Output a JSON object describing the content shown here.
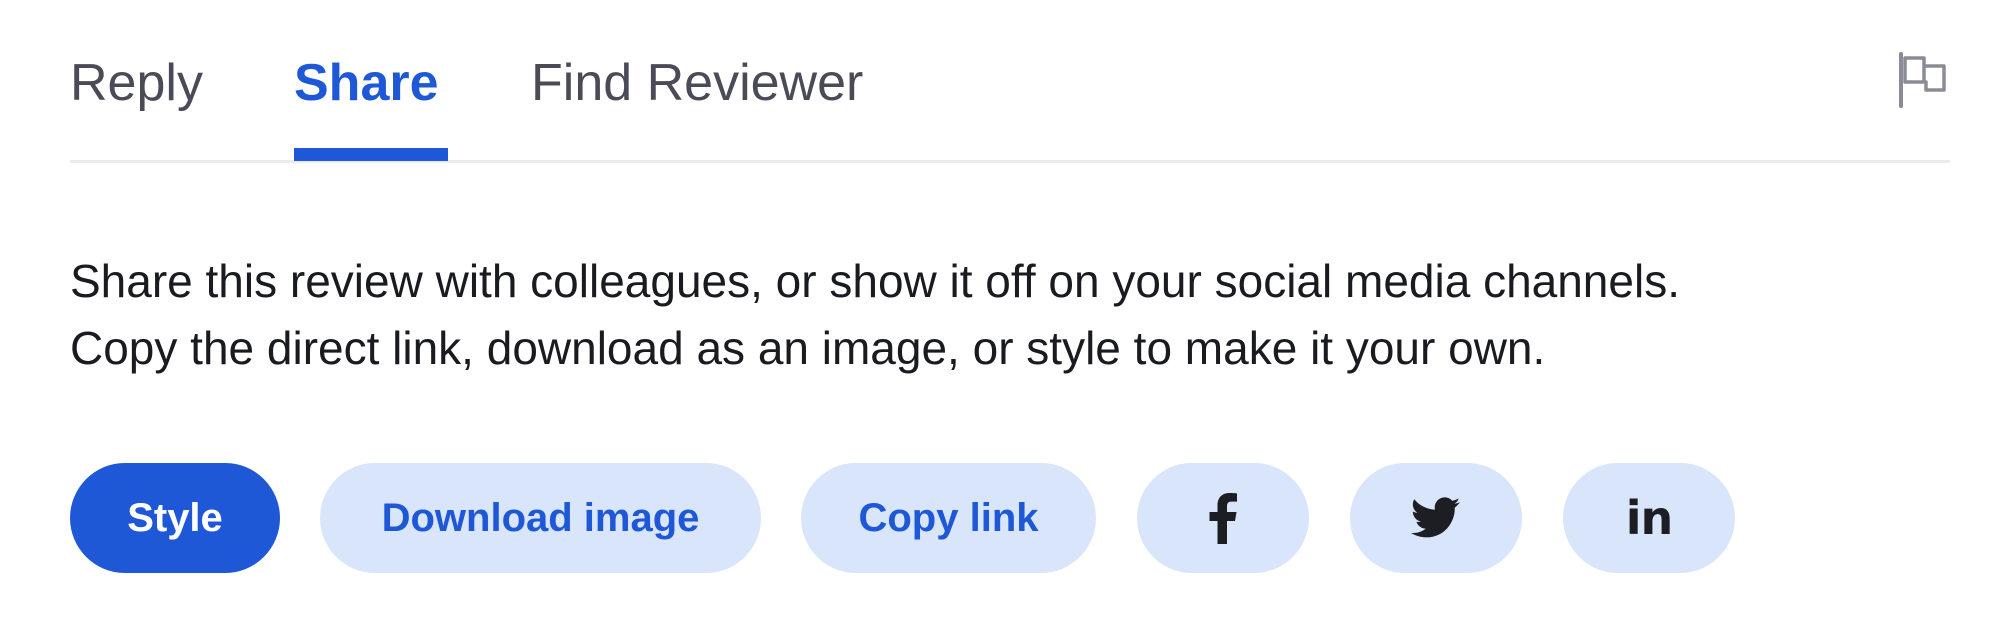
{
  "tabs": [
    {
      "label": "Reply",
      "active": false
    },
    {
      "label": "Share",
      "active": true
    },
    {
      "label": "Find Reviewer",
      "active": false
    }
  ],
  "header": {
    "flag_icon": "flag-icon"
  },
  "share": {
    "description_line1": "Share this review with colleagues, or show it off on your social media channels.",
    "description_line2": "Copy the direct link, download as an image, or style to make it your own."
  },
  "actions": {
    "style_label": "Style",
    "download_label": "Download image",
    "copy_label": "Copy link",
    "facebook_icon": "facebook-icon",
    "twitter_icon": "twitter-icon",
    "linkedin_icon": "linkedin-icon",
    "linkedin_glyph": "in"
  },
  "colors": {
    "accent": "#1e58d6",
    "pill_background": "#d9e5fb",
    "inactive_tab": "#4a4b57",
    "divider": "#ececef"
  }
}
